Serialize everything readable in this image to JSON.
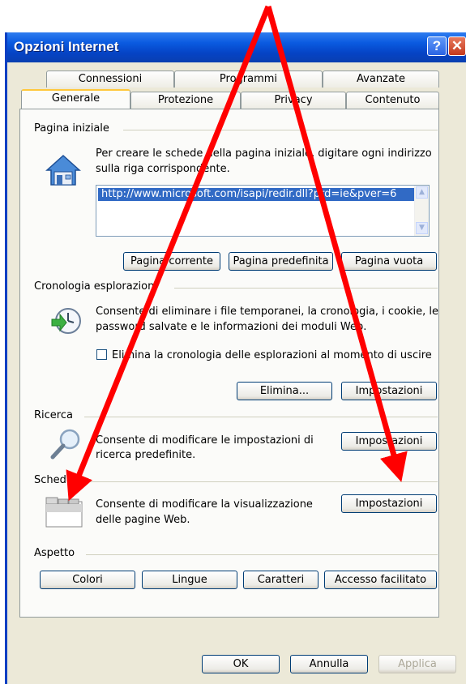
{
  "window": {
    "title": "Opzioni Internet",
    "help": "?",
    "close": "✕"
  },
  "tabs_row1": [
    "Connessioni",
    "Programmi",
    "Avanzate"
  ],
  "tabs_row2": [
    "Generale",
    "Protezione",
    "Privacy",
    "Contenuto"
  ],
  "home": {
    "label": "Pagina iniziale",
    "desc1": "Per creare le schede della pagina iniziale, digitare ogni indirizzo",
    "desc2": "sulla riga corrispondente.",
    "url": "http://www.microsoft.com/isapi/redir.dll?prd=ie&pver=6",
    "btn_current": "Pagina corrente",
    "btn_default": "Pagina predefinita",
    "btn_blank": "Pagina vuota"
  },
  "history": {
    "label": "Cronologia esplorazioni",
    "desc1": "Consente di eliminare i file temporanei, la cronologia, i cookie, le",
    "desc2": "password salvate e le informazioni dei moduli Web.",
    "checkbox_label": "Elimina la cronologia delle esplorazioni al momento di uscire",
    "btn_delete": "Elimina...",
    "btn_settings": "Impostazioni"
  },
  "search": {
    "label": "Ricerca",
    "desc1": "Consente di modificare le impostazioni di",
    "desc2": "ricerca predefinite.",
    "btn_settings": "Impostazioni"
  },
  "tabs_section": {
    "label": "Schede",
    "desc1": "Consente di modificare la visualizzazione",
    "desc2": "delle pagine Web.",
    "btn_settings": "Impostazioni"
  },
  "appearance": {
    "label": "Aspetto",
    "btn_colors": "Colori",
    "btn_languages": "Lingue",
    "btn_fonts": "Caratteri",
    "btn_accessibility": "Accesso facilitato"
  },
  "footer": {
    "ok": "OK",
    "cancel": "Annulla",
    "apply": "Applica"
  },
  "colors": {
    "titlebar": "#0a5ae0",
    "arrow": "#ff0000",
    "face": "#ece9d8"
  }
}
